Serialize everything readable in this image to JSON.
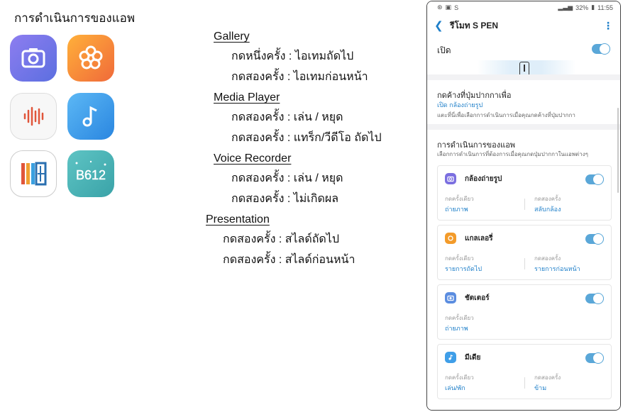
{
  "left": {
    "title": "การดำเนินการของแอพ",
    "icons": [
      "camera-app-icon",
      "gallery-app-icon",
      "voice-recorder-app-icon",
      "music-app-icon",
      "video-editor-app-icon",
      "b612-app-icon"
    ],
    "b612_text": "B612"
  },
  "middle": {
    "gallery": {
      "title": "Gallery",
      "line1": "กดหนึ่งครั้ง : ไอเทมถัดไป",
      "line2": "กดสองครั้ง : ไอเทมก่อนหน้า"
    },
    "media_player": {
      "title": "Media Player",
      "line1": "กดสองครั้ง : เล่น / หยุด",
      "line2": "กดสองครั้ง : แทร็ก/วีดีโอ ถัดไป"
    },
    "voice_recorder": {
      "title": "Voice Recorder",
      "line1": "กดสองครั้ง : เล่น / หยุด",
      "line2": "กดสองครั้ง : ไม่เกิดผล"
    },
    "presentation": {
      "title": "Presentation",
      "line1": "กดสองครั้ง : สไลด์ถัดไป",
      "line2": "กดสองครั้ง : สไลด์ก่อนหน้า"
    }
  },
  "phone": {
    "status": {
      "battery": "32%",
      "time": "11:55",
      "s_label": "S"
    },
    "appbar": {
      "title": "รีโมท S PEN"
    },
    "open": {
      "label": "เปิด",
      "enabled": true
    },
    "hold": {
      "title": "กดค้างที่ปุ่มปากกาเพื่อ",
      "value": "เปิด กล้องถ่ายรูป",
      "desc": "แตะที่นี่เพื่อเลือกการดำเนินการเมื่อคุณกดค้างที่ปุ่มปากกา"
    },
    "app_actions": {
      "title": "การดำเนินการของแอพ",
      "desc": "เลือกการดำเนินการที่ต้องการเมื่อคุณกดปุ่มปากกาในแอพต่างๆ",
      "cards": [
        {
          "name": "กล้องถ่ายรูป",
          "icon": "camera-icon",
          "color": "#7b6fe0",
          "single_label": "กดครั้งเดียว",
          "single_value": "ถ่ายภาพ",
          "double_label": "กดสองครั้ง",
          "double_value": "สลับกล้อง"
        },
        {
          "name": "แกลเลอรี่",
          "icon": "gallery-icon",
          "color": "#f39b2a",
          "single_label": "กดครั้งเดียว",
          "single_value": "รายการถัดไป",
          "double_label": "กดสองครั้ง",
          "double_value": "รายการก่อนหน้า"
        },
        {
          "name": "ชัตเตอร์",
          "icon": "shutter-icon",
          "color": "#5b8de0",
          "single_label": "กดครั้งเดียว",
          "single_value": "ถ่ายภาพ",
          "double_label": "",
          "double_value": ""
        },
        {
          "name": "มีเดีย",
          "icon": "music-icon",
          "color": "#3f9ee8",
          "single_label": "กดครั้งเดียว",
          "single_value": "เล่น/พัก",
          "double_label": "กดสองครั้ง",
          "double_value": "ข้าม"
        }
      ]
    }
  }
}
